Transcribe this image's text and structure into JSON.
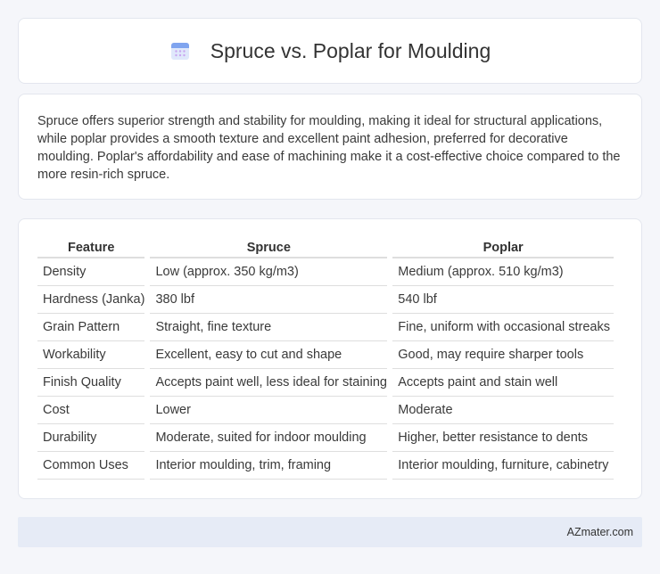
{
  "header": {
    "title": "Spruce vs. Poplar for Moulding",
    "icon": "calendar-icon"
  },
  "summary": {
    "text": "Spruce offers superior strength and stability for moulding, making it ideal for structural applications, while poplar provides a smooth texture and excellent paint adhesion, preferred for decorative moulding. Poplar's affordability and ease of machining make it a cost-effective choice compared to the more resin-rich spruce."
  },
  "table": {
    "headers": [
      "Feature",
      "Spruce",
      "Poplar"
    ],
    "rows": [
      [
        "Density",
        "Low (approx. 350 kg/m3)",
        "Medium (approx. 510 kg/m3)"
      ],
      [
        "Hardness (Janka)",
        "380 lbf",
        "540 lbf"
      ],
      [
        "Grain Pattern",
        "Straight, fine texture",
        "Fine, uniform with occasional streaks"
      ],
      [
        "Workability",
        "Excellent, easy to cut and shape",
        "Good, may require sharper tools"
      ],
      [
        "Finish Quality",
        "Accepts paint well, less ideal for staining",
        "Accepts paint and stain well"
      ],
      [
        "Cost",
        "Lower",
        "Moderate"
      ],
      [
        "Durability",
        "Moderate, suited for indoor moulding",
        "Higher, better resistance to dents"
      ],
      [
        "Common Uses",
        "Interior moulding, trim, framing",
        "Interior moulding, furniture, cabinetry"
      ]
    ]
  },
  "footer": {
    "brand": "AZmater.com"
  },
  "colors": {
    "background": "#f5f6fa",
    "card": "#ffffff",
    "footer_bar": "#e6ebf6",
    "accent": "#6b8fd8"
  }
}
